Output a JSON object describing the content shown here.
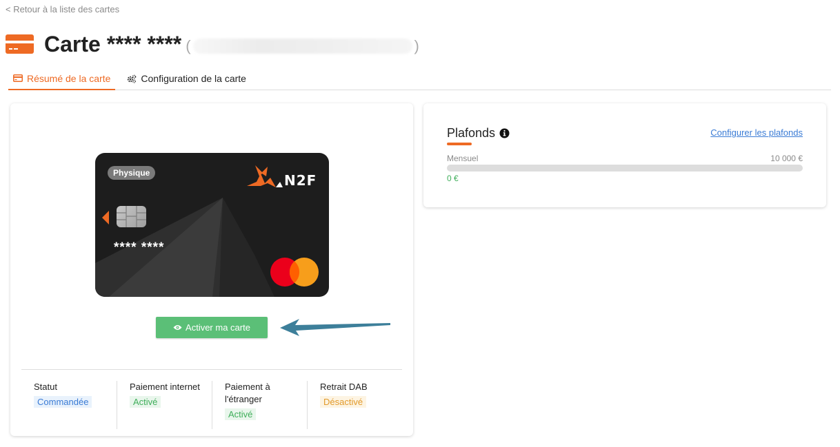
{
  "nav": {
    "back_label": "< Retour à la liste des cartes"
  },
  "header": {
    "title": "Carte **** ****",
    "paren_open": "(",
    "paren_close": ")"
  },
  "tabs": [
    {
      "label": "Résumé de la carte",
      "icon": "credit-card-icon",
      "active": true
    },
    {
      "label": "Configuration de la carte",
      "icon": "gears-icon",
      "active": false
    }
  ],
  "card": {
    "type_badge": "Physique",
    "logo_text": "N2F",
    "number": "**** ****",
    "brand": "mastercard-logo"
  },
  "activate_button": {
    "label": "Activer ma carte",
    "icon": "eye-icon",
    "color": "#5bbf77"
  },
  "status": [
    {
      "label": "Statut",
      "value": "Commandée",
      "tone": "blue"
    },
    {
      "label": "Paiement internet",
      "value": "Activé",
      "tone": "green"
    },
    {
      "label": "Paiement à l'étranger",
      "value": "Activé",
      "tone": "green"
    },
    {
      "label": "Retrait DAB",
      "value": "Désactivé",
      "tone": "orange"
    }
  ],
  "plafonds": {
    "title": "Plafonds",
    "info_icon": "info-circle-icon",
    "configure_link": "Configurer les plafonds",
    "period_label": "Mensuel",
    "max_amount": "10 000 €",
    "used_amount": "0 €",
    "used_fraction": 0
  },
  "colors": {
    "accent": "#ee6a24",
    "success": "#5bbf77",
    "link": "#3a7bd5",
    "callout": "#3d7f9a"
  }
}
